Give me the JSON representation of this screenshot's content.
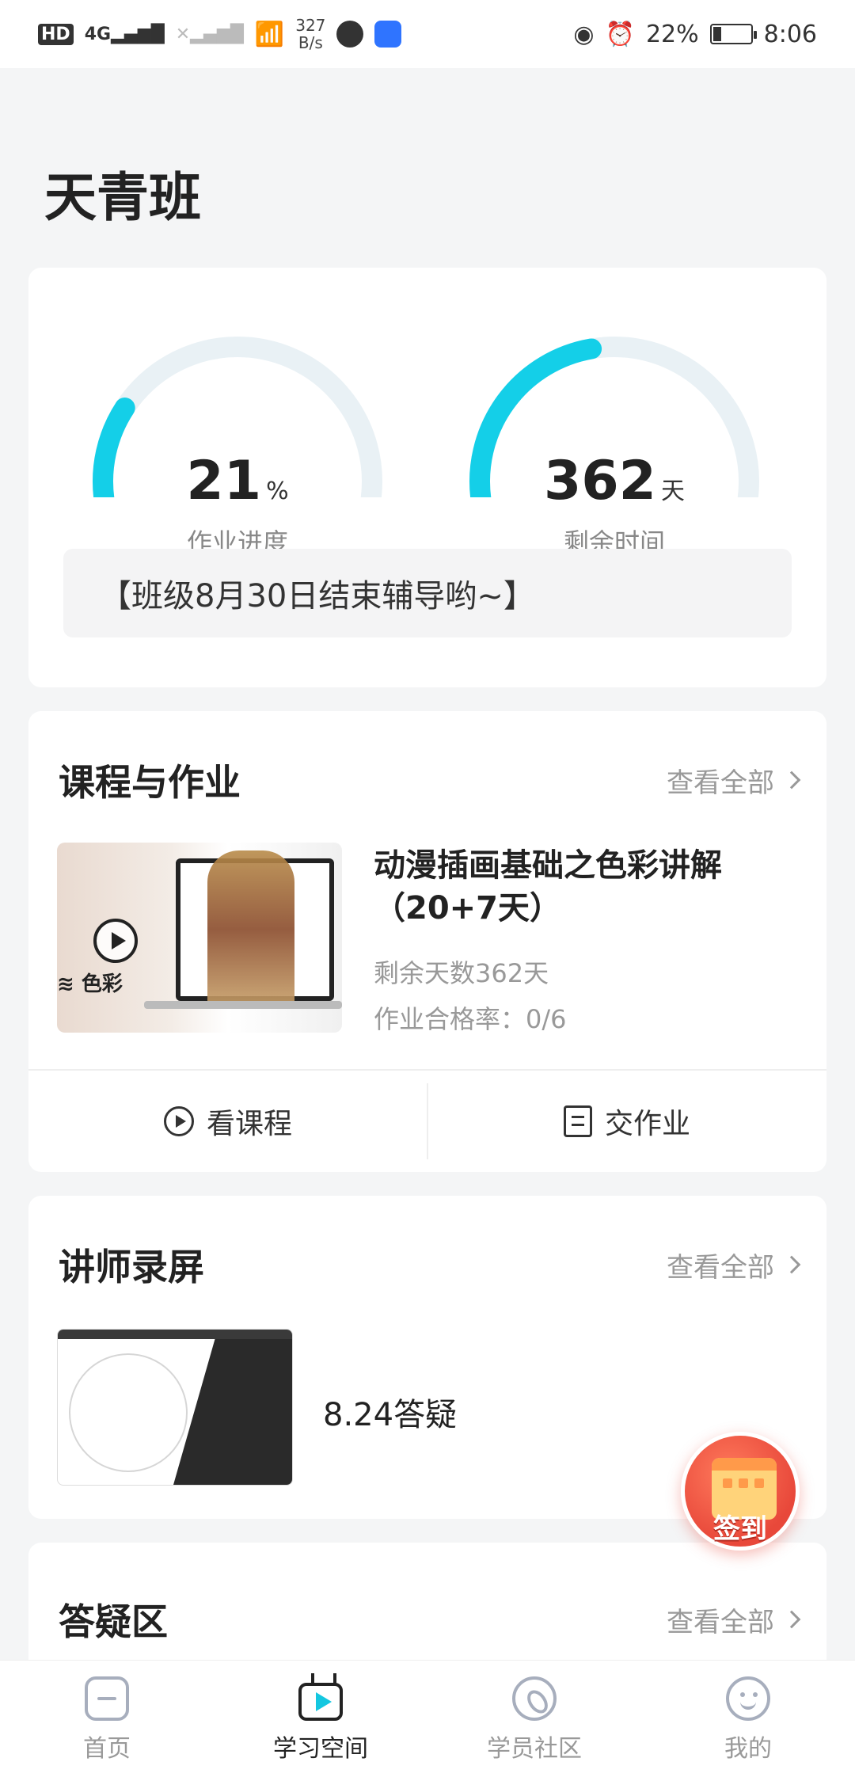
{
  "status_bar": {
    "network_tag": "HD",
    "signal_label": "4G",
    "speed_value": "327",
    "speed_unit": "B/s",
    "battery": "22%",
    "battery_level": 0.22,
    "time": "8:06"
  },
  "page": {
    "title": "天青班"
  },
  "progress": {
    "homework": {
      "value": "21",
      "unit": "%",
      "label": "作业进度",
      "fraction": 0.21
    },
    "remaining": {
      "value": "362",
      "unit": "天",
      "label": "剩余时间",
      "fraction": 0.45
    },
    "notice": "【班级8月30日结束辅导哟~】",
    "colors": {
      "track": "#e9f1f5",
      "fill": "#14cfe8"
    }
  },
  "courses": {
    "title": "课程与作业",
    "see_all": "查看全部",
    "item": {
      "thumb_tag": "≋ 色彩",
      "title": "动漫插画基础之色彩讲解（20+7天）",
      "remaining": "剩余天数362天",
      "pass_rate": "作业合格率：0/6"
    },
    "actions": {
      "watch": "看课程",
      "submit": "交作业"
    }
  },
  "lectures": {
    "title": "讲师录屏",
    "see_all": "查看全部",
    "item": {
      "title": "8.24答疑"
    }
  },
  "qa": {
    "title": "答疑区",
    "see_all": "查看全部"
  },
  "signin": {
    "label": "签到"
  },
  "tabbar": {
    "tabs": [
      {
        "label": "首页",
        "icon": "home-icon"
      },
      {
        "label": "学习空间",
        "icon": "study-space-icon",
        "active": true
      },
      {
        "label": "学员社区",
        "icon": "community-compass-icon"
      },
      {
        "label": "我的",
        "icon": "profile-face-icon"
      }
    ]
  }
}
